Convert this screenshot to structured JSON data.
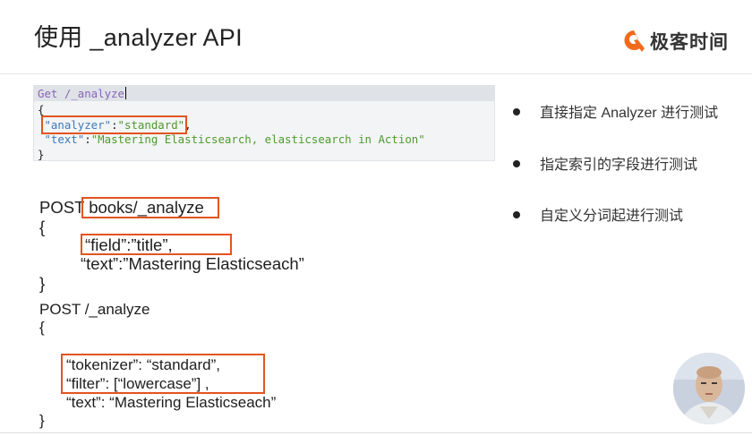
{
  "title": "使用 _analyzer API",
  "brand": {
    "name": "极客时间",
    "logo_icon": "geektime-logo",
    "accent": "#f26b1d"
  },
  "editor": {
    "request_line": "Get /_analyze",
    "line_open": "{",
    "line_analyzer_key": "\"analyzer\"",
    "line_analyzer_colon": ":",
    "line_analyzer_value": "\"standard\"",
    "line_analyzer_comma": ",",
    "line_text_key": "\"text\"",
    "line_text_colon": ":",
    "line_text_value": "\"Mastering Elasticsearch, elasticsearch in Action\"",
    "line_close": "}"
  },
  "example2": {
    "method": "POST ",
    "path": "books/_analyze",
    "open": "{",
    "field_line": "“field”:”title”,",
    "text_line": "“text”:”Mastering Elasticseach”",
    "close": "}"
  },
  "example3": {
    "request": "POST /_analyze",
    "open": "{",
    "tokenizer_line": "“tokenizer”: “standard”,",
    "filter_line": "“filter”: [“lowercase”] ,",
    "text_line": "“text”: “Mastering Elasticseach”",
    "close": "}"
  },
  "bullets": [
    "直接指定 Analyzer 进行测试",
    "指定索引的字段进行测试",
    "自定义分词起进行测试"
  ],
  "colors": {
    "highlight_box": "#e2541f",
    "json_key": "#3d7ab8",
    "json_value": "#4e9a2e",
    "request_line": "#8a63b6"
  }
}
